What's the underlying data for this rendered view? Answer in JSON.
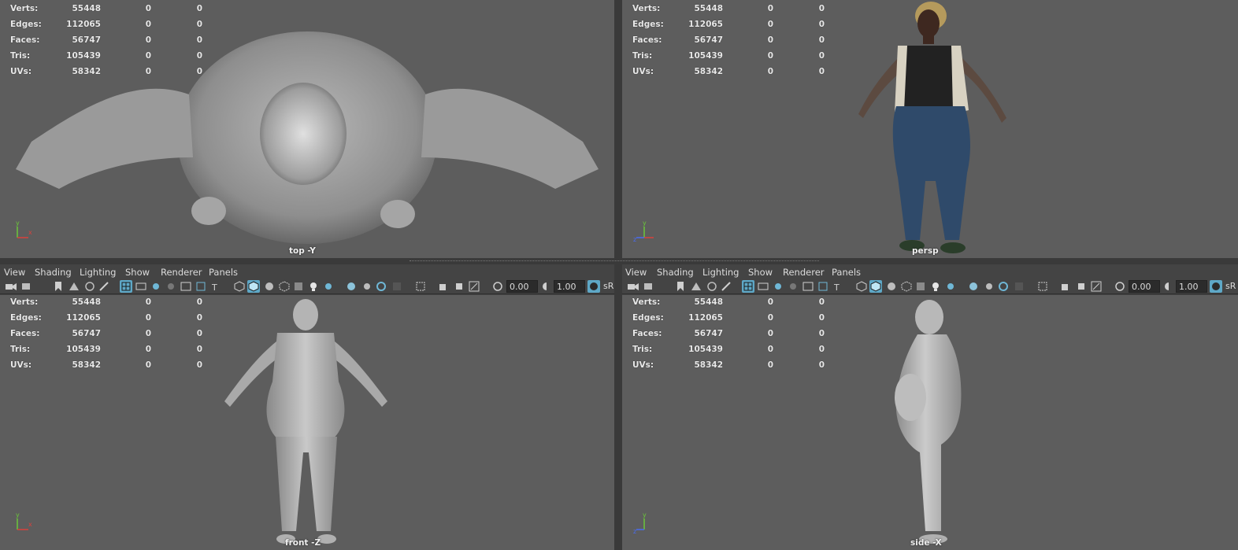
{
  "stats_labels": {
    "verts": "Verts:",
    "edges": "Edges:",
    "faces": "Faces:",
    "tris": "Tris:",
    "uvs": "UVs:"
  },
  "stats_values": {
    "verts": [
      "55448",
      "0",
      "0"
    ],
    "edges": [
      "112065",
      "0",
      "0"
    ],
    "faces": [
      "56747",
      "0",
      "0"
    ],
    "tris": [
      "105439",
      "0",
      "0"
    ],
    "uvs": [
      "58342",
      "0",
      "0"
    ]
  },
  "viewports": {
    "top": {
      "camera": "top -Y"
    },
    "persp": {
      "camera": "persp"
    },
    "front": {
      "camera": "front -Z"
    },
    "side": {
      "camera": "side -X"
    }
  },
  "panel_menu": [
    "View",
    "Shading",
    "Lighting",
    "Show",
    "Renderer",
    "Panels"
  ],
  "toolbar": {
    "exposure": "0.00",
    "gamma": "1.00",
    "color_space": "sR"
  },
  "axis_labels": {
    "x": "x",
    "y": "y",
    "z": "z"
  },
  "colors": {
    "viewport_bg": "#5d5d5d",
    "ui_bg": "#444444",
    "active_icon": "#5ea8c7",
    "axis_x": "#d9413d",
    "axis_y": "#6bc73a",
    "axis_z": "#4a6cf0"
  },
  "icons": [
    "camera-icon",
    "grid-icon",
    "film-gate-icon",
    "wireframe-icon",
    "smooth-shade-icon",
    "xray-icon",
    "light-icon",
    "exposure-icon",
    "gamma-icon",
    "colorspace-icon"
  ]
}
